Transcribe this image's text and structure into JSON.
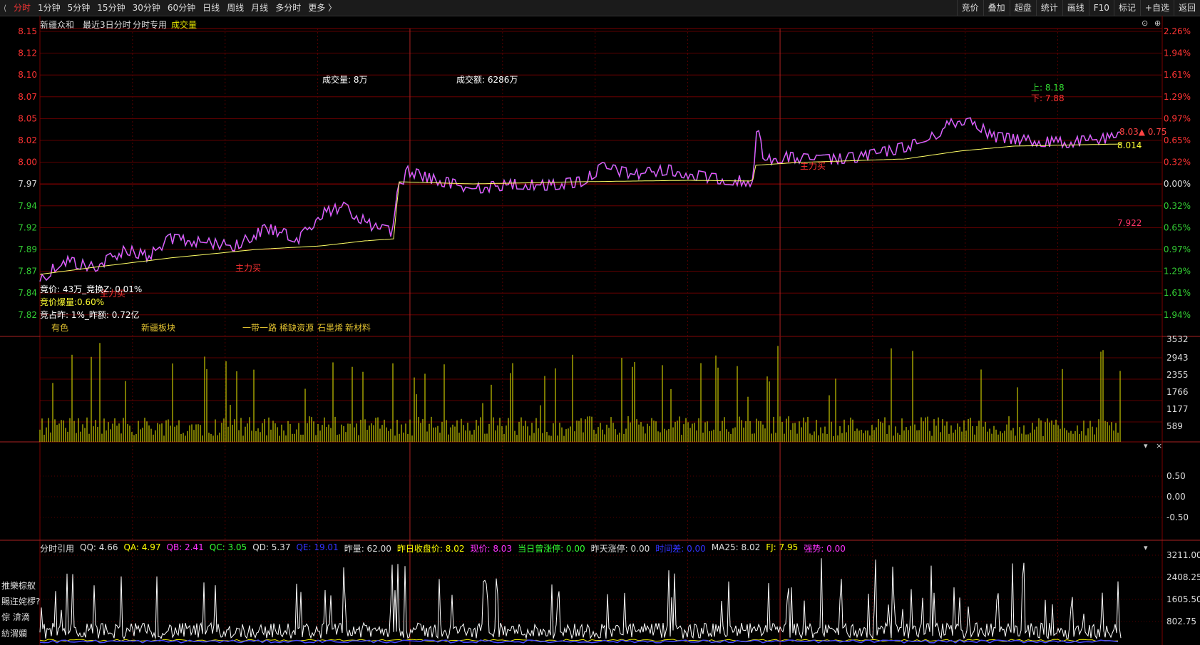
{
  "toolbar": {
    "left_items": [
      "分时",
      "1分钟",
      "5分钟",
      "15分钟",
      "30分钟",
      "60分钟",
      "日线",
      "周线",
      "月线",
      "多分时",
      "更多 〉"
    ],
    "active_index": 0,
    "right_items": [
      "竞价",
      "叠加",
      "超盘",
      "统计",
      "画线",
      "F10",
      "标记",
      "+自选",
      "返回"
    ]
  },
  "header": {
    "stock_name": "新疆众和",
    "mode": "最近3日分时",
    "special": "分时专用",
    "indicator": "成交量"
  },
  "price_axis": {
    "left": [
      "8.15",
      "8.12",
      "8.10",
      "8.07",
      "8.05",
      "8.02",
      "8.00",
      "7.97",
      "7.94",
      "7.92",
      "7.89",
      "7.87",
      "7.84",
      "7.82"
    ],
    "right": [
      "2.26%",
      "1.94%",
      "1.61%",
      "1.29%",
      "0.97%",
      "0.65%",
      "0.32%",
      "0.00%",
      "0.32%",
      "0.65%",
      "0.97%",
      "1.29%",
      "1.61%",
      "1.94%"
    ]
  },
  "overlays": {
    "volume_text": "成交量: 8万",
    "amount_text": "成交额: 6286万",
    "upper_limit": "上: 8.18",
    "lower_limit": "下: 7.88",
    "price_label": "8.03▲ 0.75",
    "avg_label": "8.014",
    "low_mark": "7.922",
    "main_buy_1": "主力买",
    "main_buy_2": "主力买",
    "main_buy_3": "主力买",
    "auction_1": "竞价: 43万_竞换Z: 0.01%",
    "auction_2": "竞价爆量:0.60%",
    "auction_3": "竞占昨: 1%_昨额: 0.72亿",
    "tags": [
      "有色",
      "新疆板块",
      "一带一路",
      "稀缺资源",
      "石墨烯",
      "新材料"
    ]
  },
  "volume_axis": [
    "3532",
    "2943",
    "2355",
    "1766",
    "1177",
    "589"
  ],
  "mid_axis": [
    "0.50",
    "0.00",
    "-0.50"
  ],
  "bottom_axis": [
    "3211.00",
    "2408.25",
    "1605.50",
    "802.75"
  ],
  "bottom_header": [
    {
      "text": "分时引用",
      "color": "#dddddd"
    },
    {
      "text": "QQ: 4.66",
      "color": "#dddddd"
    },
    {
      "text": "QA: 4.97",
      "color": "#ffff00"
    },
    {
      "text": "QB: 2.41",
      "color": "#ff33ff"
    },
    {
      "text": "QC: 3.05",
      "color": "#33ff33"
    },
    {
      "text": "QD: 5.37",
      "color": "#dddddd"
    },
    {
      "text": "QE: 19.01",
      "color": "#3333ff"
    },
    {
      "text": "昨量: 62.00",
      "color": "#dddddd"
    },
    {
      "text": "昨日收盘价: 8.02",
      "color": "#ffff00"
    },
    {
      "text": "现价: 8.03",
      "color": "#ff33ff"
    },
    {
      "text": "当日曾涨停: 0.00",
      "color": "#33ff33"
    },
    {
      "text": "昨天涨停: 0.00",
      "color": "#dddddd"
    },
    {
      "text": "时间差: 0.00",
      "color": "#3333ff"
    },
    {
      "text": "MA25: 8.02",
      "color": "#dddddd"
    },
    {
      "text": "FJ: 7.95",
      "color": "#ffff00"
    },
    {
      "text": "强势: 0.00",
      "color": "#ff33ff"
    }
  ],
  "side_labels": [
    "推樂棕舣",
    "賜迕姹椤?",
    "倧  渰滴",
    "紡渭孄"
  ],
  "panel_controls": {
    "dropdown": "▾",
    "close": "×",
    "settings": "⊙",
    "add": "⊕"
  },
  "colors": {
    "up": "#ff3333",
    "down": "#33cc33",
    "grid": "#7a0000",
    "vol": "#c8c800",
    "price": "#ff44ff",
    "avg": "#ffff66",
    "cyan": "#33ffff",
    "white": "#ffffff"
  }
}
